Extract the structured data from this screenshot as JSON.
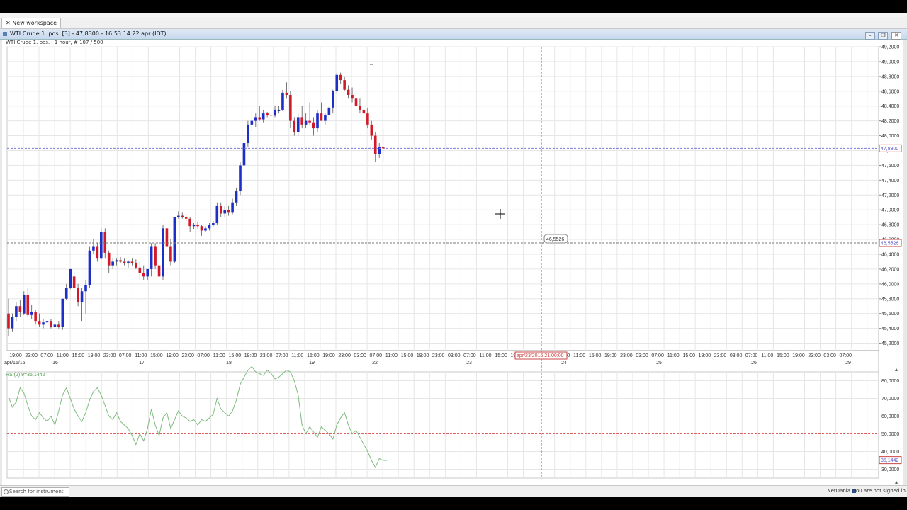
{
  "workspace_tab": "New workspace",
  "window_title": "WTI Crude 1. pos. [3] - 47,8300 - 16:53:14  22 apr (IDT)",
  "chart_subtitle": "WTI Crude 1. pos. , 1 hour, # 107 / 500",
  "price_axis_labels": [
    "49,2000",
    "49,0000",
    "48,8000",
    "48,6000",
    "48,4000",
    "48,2000",
    "48,0000",
    "47,8000",
    "47,6000",
    "47,4000",
    "47,2000",
    "47,0000",
    "46,8000",
    "46,6000",
    "46,4000",
    "46,2000",
    "46,0000",
    "45,8000",
    "45,6000",
    "45,4000",
    "45,2000"
  ],
  "current_price_tag": "47,8300",
  "crosshair_price_tag": "46,5526",
  "crosshair_readout": "46,5526",
  "crosshair_time_tag": "apr/23/2016 21:00:00",
  "date_left_label": "apr/15/16",
  "time_ticks": [
    "19:00",
    "23:00",
    "07:00",
    "11:00",
    "15:00",
    "19:00",
    "23:00",
    "07:00",
    "11:00",
    "15:00",
    "19:00",
    "23:00",
    "07:00",
    "11:00",
    "15:00",
    "19:00",
    "23:00",
    "07:00",
    "11:00",
    "15:00",
    "19:00",
    "23:00",
    "03:00",
    "07:00",
    "11:00",
    "15:00",
    "19:00",
    "23:00",
    "03:00",
    "07:00",
    "11:00",
    "15:00",
    "19:00",
    "23:00",
    "03:00",
    "07:00",
    "11:00",
    "15:00",
    "19:00",
    "23:00",
    "03:00",
    "07:00",
    "11:00",
    "15:00",
    "19:00",
    "23:00",
    "03:00",
    "07:00",
    "11:00",
    "15:00",
    "19:00",
    "23:00",
    "03:00",
    "07:00"
  ],
  "date_ticks": [
    "16",
    "17",
    "18",
    "19",
    "22",
    "23",
    "24",
    "25",
    "26",
    "29"
  ],
  "rsi_label": "RSI(2) 9=35,1442",
  "rsi_axis_labels": [
    "80,0000",
    "70,0000",
    "60,0000",
    "50,0000",
    "40,0000",
    "30,0000"
  ],
  "rsi_current_tag": "35,1442",
  "search_placeholder": "Search for instrument",
  "brand": "NetDania",
  "signin_status": "You are not signed in",
  "colors": {
    "up": "#1c2fc9",
    "down": "#d11a2a",
    "rsi": "#7dbb7d",
    "grid": "#e6e6e6",
    "current_line": "#7b7bd6",
    "cross_line": "#777777",
    "rsi_mid": "#e06060"
  },
  "chart_data": {
    "type": "candlestick",
    "candles": [
      [
        45.6,
        45.8,
        45.3,
        45.4
      ],
      [
        45.4,
        45.6,
        45.35,
        45.55
      ],
      [
        45.55,
        45.75,
        45.5,
        45.7
      ],
      [
        45.7,
        45.78,
        45.55,
        45.62
      ],
      [
        45.6,
        45.9,
        45.58,
        45.85
      ],
      [
        45.85,
        45.95,
        45.55,
        45.58
      ],
      [
        45.58,
        45.72,
        45.52,
        45.62
      ],
      [
        45.62,
        45.65,
        45.45,
        45.5
      ],
      [
        45.5,
        45.6,
        45.42,
        45.45
      ],
      [
        45.45,
        45.52,
        45.4,
        45.48
      ],
      [
        45.48,
        45.55,
        45.45,
        45.5
      ],
      [
        45.5,
        45.52,
        45.4,
        45.42
      ],
      [
        45.42,
        45.48,
        45.35,
        45.45
      ],
      [
        45.45,
        45.5,
        45.4,
        45.42
      ],
      [
        45.42,
        45.6,
        45.38,
        45.8
      ],
      [
        45.8,
        46.0,
        45.78,
        45.95
      ],
      [
        45.95,
        46.2,
        45.93,
        46.2
      ],
      [
        46.1,
        46.15,
        45.9,
        45.95
      ],
      [
        45.95,
        46.0,
        45.7,
        45.75
      ],
      [
        45.75,
        45.95,
        45.5,
        45.9
      ],
      [
        45.9,
        46.05,
        45.6,
        45.98
      ],
      [
        45.98,
        46.5,
        45.95,
        46.45
      ],
      [
        46.45,
        46.6,
        46.4,
        46.5
      ],
      [
        46.5,
        46.55,
        46.3,
        46.35
      ],
      [
        46.35,
        46.75,
        46.33,
        46.7
      ],
      [
        46.7,
        46.75,
        46.35,
        46.42
      ],
      [
        46.42,
        46.45,
        46.15,
        46.25
      ],
      [
        46.25,
        46.35,
        46.2,
        46.3
      ],
      [
        46.3,
        46.35,
        46.25,
        46.32
      ],
      [
        46.32,
        46.36,
        46.28,
        46.3
      ],
      [
        46.3,
        46.35,
        46.25,
        46.28
      ],
      [
        46.28,
        46.32,
        46.22,
        46.3
      ],
      [
        46.3,
        46.35,
        46.25,
        46.28
      ],
      [
        46.28,
        46.33,
        46.2,
        46.22
      ],
      [
        46.22,
        46.3,
        46.05,
        46.15
      ],
      [
        46.15,
        46.25,
        46.05,
        46.1
      ],
      [
        46.1,
        46.2,
        46.05,
        46.2
      ],
      [
        46.2,
        46.55,
        46.1,
        46.5
      ],
      [
        46.5,
        46.55,
        46.2,
        46.25
      ],
      [
        46.25,
        46.35,
        45.9,
        46.1
      ],
      [
        46.1,
        46.8,
        46.05,
        46.75
      ],
      [
        46.75,
        46.78,
        46.45,
        46.5
      ],
      [
        46.5,
        46.6,
        46.25,
        46.3
      ],
      [
        46.3,
        46.9,
        46.28,
        46.9
      ],
      [
        46.9,
        46.98,
        46.88,
        46.92
      ],
      [
        46.92,
        46.96,
        46.88,
        46.9
      ],
      [
        46.9,
        46.94,
        46.85,
        46.88
      ],
      [
        46.88,
        46.9,
        46.7,
        46.78
      ],
      [
        46.78,
        46.82,
        46.74,
        46.8
      ],
      [
        46.8,
        46.83,
        46.75,
        46.78
      ],
      [
        46.78,
        46.8,
        46.65,
        46.72
      ],
      [
        46.72,
        46.78,
        46.7,
        46.75
      ],
      [
        46.75,
        46.82,
        46.72,
        46.8
      ],
      [
        46.8,
        46.85,
        46.77,
        46.82
      ],
      [
        46.82,
        47.1,
        46.8,
        47.05
      ],
      [
        47.05,
        47.1,
        46.9,
        46.95
      ],
      [
        46.95,
        47.05,
        46.9,
        47.0
      ],
      [
        47.0,
        47.05,
        46.92,
        46.96
      ],
      [
        46.96,
        47.15,
        46.94,
        47.1
      ],
      [
        47.1,
        47.3,
        47.05,
        47.25
      ],
      [
        47.25,
        47.65,
        47.2,
        47.6
      ],
      [
        47.6,
        47.95,
        47.55,
        47.9
      ],
      [
        47.9,
        48.2,
        47.85,
        48.15
      ],
      [
        48.15,
        48.35,
        48.05,
        48.2
      ],
      [
        48.2,
        48.3,
        48.12,
        48.25
      ],
      [
        48.25,
        48.4,
        48.2,
        48.22
      ],
      [
        48.22,
        48.35,
        48.18,
        48.3
      ],
      [
        48.3,
        48.32,
        48.25,
        48.28
      ],
      [
        48.28,
        48.3,
        48.24,
        48.27
      ],
      [
        48.27,
        48.4,
        48.25,
        48.35
      ],
      [
        48.35,
        48.4,
        48.3,
        48.35
      ],
      [
        48.35,
        48.62,
        48.33,
        48.58
      ],
      [
        48.58,
        48.72,
        48.5,
        48.55
      ],
      [
        48.55,
        48.6,
        48.1,
        48.2
      ],
      [
        48.2,
        48.25,
        48.0,
        48.05
      ],
      [
        48.05,
        48.3,
        48.0,
        48.25
      ],
      [
        48.25,
        48.4,
        48.1,
        48.15
      ],
      [
        48.15,
        48.3,
        48.1,
        48.2
      ],
      [
        48.2,
        48.45,
        48.15,
        48.18
      ],
      [
        48.18,
        48.25,
        48.0,
        48.1
      ],
      [
        48.1,
        48.35,
        48.05,
        48.3
      ],
      [
        48.3,
        48.45,
        48.25,
        48.2
      ],
      [
        48.2,
        48.3,
        48.15,
        48.28
      ],
      [
        48.28,
        48.4,
        48.22,
        48.38
      ],
      [
        48.38,
        48.62,
        48.3,
        48.6
      ],
      [
        48.6,
        48.85,
        48.58,
        48.82
      ],
      [
        48.82,
        48.85,
        48.7,
        48.75
      ],
      [
        48.75,
        48.8,
        48.6,
        48.62
      ],
      [
        48.62,
        48.68,
        48.5,
        48.55
      ],
      [
        48.55,
        48.65,
        48.45,
        48.5
      ],
      [
        48.5,
        48.55,
        48.35,
        48.4
      ],
      [
        48.4,
        48.5,
        48.3,
        48.35
      ],
      [
        48.35,
        48.42,
        48.2,
        48.3
      ],
      [
        48.3,
        48.38,
        48.1,
        48.15
      ],
      [
        48.15,
        48.2,
        47.95,
        48.0
      ],
      [
        48.0,
        48.05,
        47.65,
        47.75
      ],
      [
        47.75,
        47.9,
        47.7,
        47.85
      ],
      [
        47.85,
        48.1,
        47.65,
        47.83
      ]
    ],
    "rsi": [
      71,
      65,
      68,
      76,
      73,
      66,
      60,
      58,
      62,
      59,
      57,
      60,
      55,
      63,
      72,
      76,
      70,
      64,
      60,
      57,
      62,
      69,
      74,
      76,
      72,
      66,
      60,
      58,
      62,
      57,
      55,
      53,
      49,
      44,
      50,
      46,
      53,
      64,
      55,
      49,
      59,
      62,
      53,
      58,
      63,
      60,
      59,
      57,
      58,
      55,
      58,
      57,
      59,
      61,
      70,
      64,
      62,
      60,
      63,
      69,
      78,
      82,
      86,
      88,
      85,
      84,
      83,
      86,
      84,
      81,
      82,
      84,
      86,
      85,
      80,
      72,
      55,
      50,
      54,
      51,
      48,
      54,
      52,
      50,
      47,
      55,
      59,
      62,
      55,
      50,
      52,
      48,
      44,
      40,
      35,
      31,
      36,
      35,
      35
    ],
    "price_range": [
      45.1,
      49.2
    ],
    "rsi_range": [
      25,
      85
    ],
    "current_price": 47.83,
    "crosshair_price": 46.5526
  }
}
